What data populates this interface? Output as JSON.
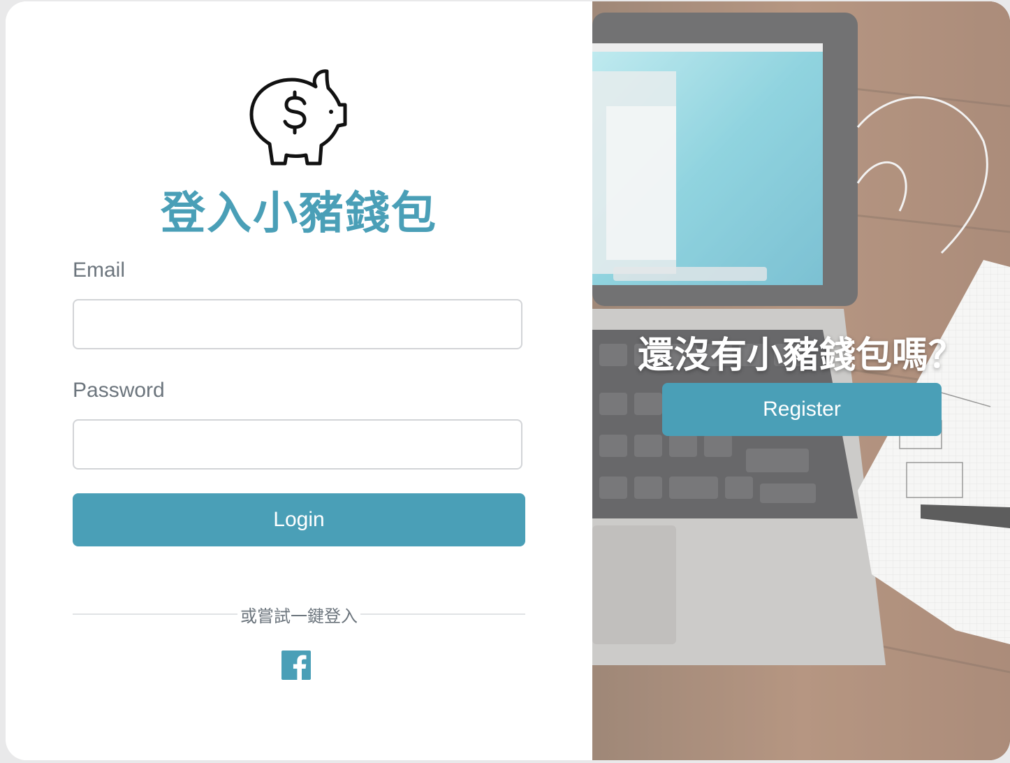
{
  "app": {
    "title": "登入小豬錢包",
    "logo_icon": "piggy-bank-dollar-icon",
    "accent_color": "#4a9fb7"
  },
  "login_form": {
    "email_label": "Email",
    "email_value": "",
    "password_label": "Password",
    "password_value": "",
    "login_button": "Login"
  },
  "social": {
    "divider_text": "或嘗試一鍵登入",
    "facebook_icon": "facebook-icon"
  },
  "register_panel": {
    "prompt": "還沒有小豬錢包嗎？",
    "register_button": "Register",
    "background": "photo of laptop, notebook and earphones on wooden desk"
  }
}
